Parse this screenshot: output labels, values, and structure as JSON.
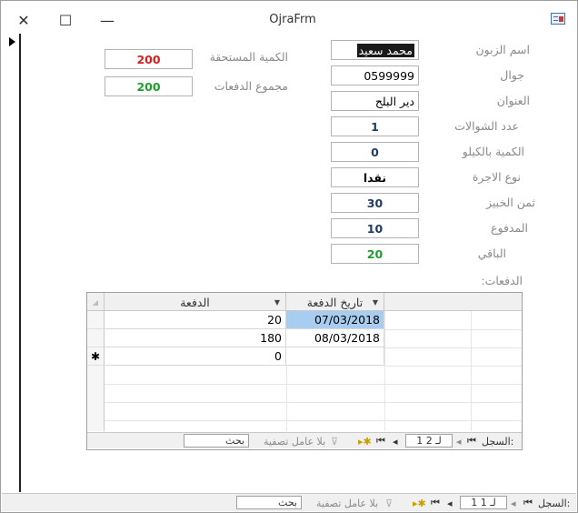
{
  "window": {
    "title": "OjraFrm",
    "close_glyph": "✕",
    "max_glyph": "☐",
    "min_glyph": "—"
  },
  "form": {
    "customer_name_label": "اسم الزبون",
    "customer_name": "محمد سعيد",
    "mobile_label": "جوال",
    "mobile": "0599999",
    "address_label": "العنوان",
    "address": "دير البلح",
    "bags_label": "عدد الشوالات",
    "bags": "1",
    "kg_label": "الكمية بالكيلو",
    "kg": "0",
    "fee_type_label": "نوع الاجرة",
    "fee_type": "نقدا",
    "bread_price_label": "ثمن الخبيز",
    "bread_price": "30",
    "paid_label": "المدفوع",
    "paid": "10",
    "remaining_label": "الباقي",
    "remaining": "20",
    "due_label": "الكمية المستحقة",
    "due": "200",
    "payments_total_label": "مجموع الدفعات",
    "payments_total": "200",
    "payments_label": "الدفعات:"
  },
  "colors": {
    "red": "#d42020",
    "green": "#1e9e2e",
    "navy": "#1f3b64"
  },
  "subform": {
    "col_date": "تاريخ الدفعة",
    "col_payment": "الدفعة",
    "rows": [
      {
        "date": "07/03/2018",
        "payment": "20"
      },
      {
        "date": "08/03/2018",
        "payment": "180"
      },
      {
        "date": "",
        "payment": "0"
      }
    ],
    "new_row_marker": "✱",
    "nav": {
      "record_label": "السجل:",
      "position": "1 ﻟـ 2",
      "filter": "بلا عامل تصفية",
      "search": "بحث"
    }
  },
  "main_nav": {
    "record_label": "السجل:",
    "position": "1 ﻟـ 1",
    "filter": "بلا عامل تصفية",
    "search": "بحث"
  }
}
